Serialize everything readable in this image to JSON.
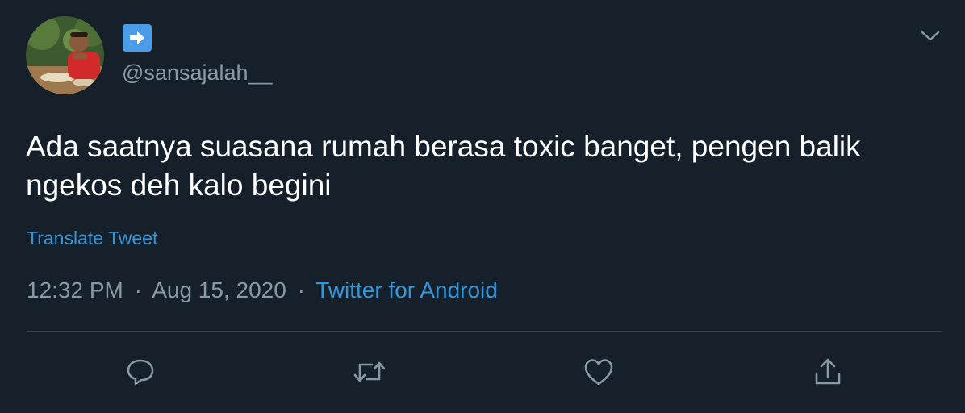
{
  "tweet": {
    "handle": "@sansajalah__",
    "text": "Ada saatnya suasana rumah berasa toxic banget, pengen balik ngekos deh kalo begini",
    "translate_label": "Translate Tweet",
    "time": "12:32 PM",
    "date": "Aug 15, 2020",
    "separator": "·",
    "source": "Twitter for Android"
  },
  "icons": {
    "badge": "arrow-right-icon",
    "menu": "chevron-down-icon",
    "reply": "reply-icon",
    "retweet": "retweet-icon",
    "like": "heart-icon",
    "share": "share-icon"
  },
  "colors": {
    "background": "#15202b",
    "text": "#ffffff",
    "secondary": "#8899a6",
    "link": "#3396d8",
    "badge": "#4a9ce8",
    "divider": "#38444d"
  }
}
